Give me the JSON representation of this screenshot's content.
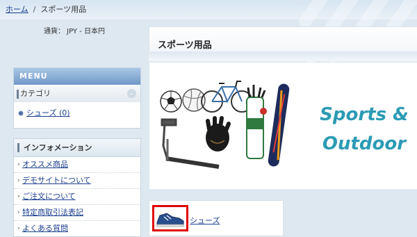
{
  "breadcrumb": {
    "home": "ホーム",
    "separator": "/",
    "current": "スポーツ用品"
  },
  "currency": {
    "label": "通貨：",
    "value": "JPY - 日本円"
  },
  "menu": {
    "header": "MENU",
    "category_label": "カテゴリ",
    "items": [
      {
        "label": "シューズ (0)"
      }
    ]
  },
  "info": {
    "header": "インフォメーション",
    "items": [
      {
        "label": "オススメ商品"
      },
      {
        "label": "デモサイトについて"
      },
      {
        "label": "ご注文について"
      },
      {
        "label": "特定商取引法表記"
      },
      {
        "label": "よくある質問"
      }
    ]
  },
  "main": {
    "title": "スポーツ用品",
    "banner_text_line1": "Sports &",
    "banner_text_line2": "Outdoor",
    "subcategory": {
      "label": "シューズ"
    }
  },
  "colors": {
    "accent": "#2c9bb4",
    "link": "#1b3f8f",
    "menu_header": "#6f98c7",
    "highlight": "#e00000"
  }
}
